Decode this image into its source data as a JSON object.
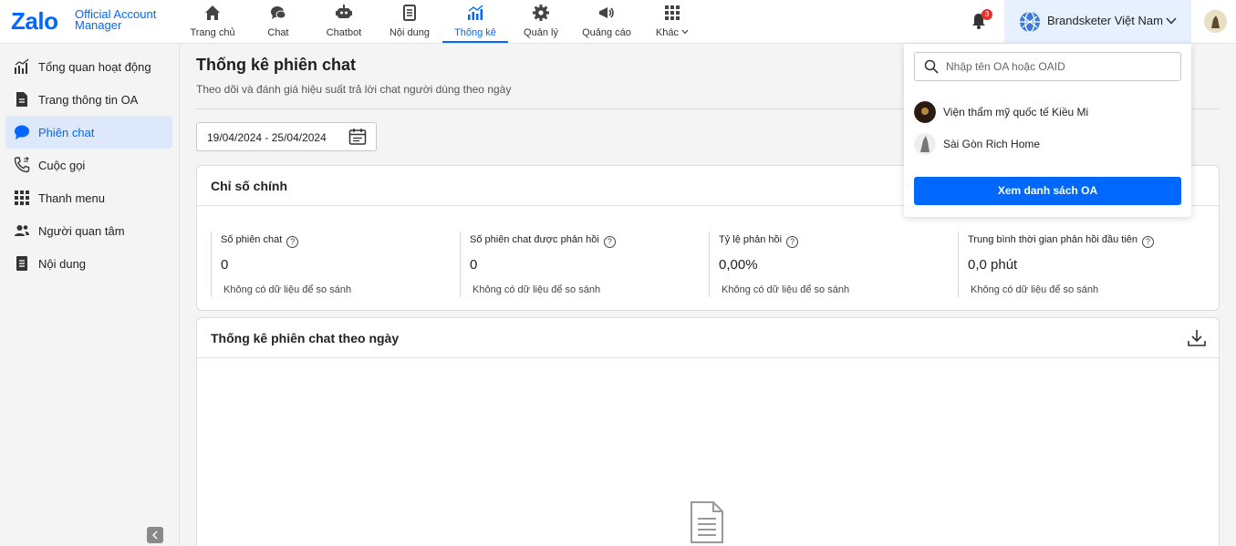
{
  "brand": {
    "logo_text": "Zalo",
    "logo_sub_1": "Official Account",
    "logo_sub_2": "Manager",
    "accent": "#0068ff"
  },
  "nav": {
    "items": [
      {
        "label": "Trang chủ",
        "icon": "home-icon"
      },
      {
        "label": "Chat",
        "icon": "chat-bubbles-icon"
      },
      {
        "label": "Chatbot",
        "icon": "robot-icon"
      },
      {
        "label": "Nội dung",
        "icon": "document-list-icon"
      },
      {
        "label": "Thống kê",
        "icon": "bar-chart-icon",
        "active": true
      },
      {
        "label": "Quản lý",
        "icon": "gear-icon"
      },
      {
        "label": "Quảng cáo",
        "icon": "megaphone-icon"
      },
      {
        "label": "Khác",
        "icon": "grid-icon"
      }
    ],
    "notification_count": "3",
    "account_name": "Brandsketer Việt Nam"
  },
  "sidebar": {
    "items": [
      {
        "label": "Tổng quan hoạt động",
        "icon": "stats-icon"
      },
      {
        "label": "Trang thông tin OA",
        "icon": "info-page-icon"
      },
      {
        "label": "Phiên chat",
        "icon": "chat-icon",
        "active": true
      },
      {
        "label": "Cuộc gọi",
        "icon": "phone-icon"
      },
      {
        "label": "Thanh menu",
        "icon": "grid-icon"
      },
      {
        "label": "Người quan tâm",
        "icon": "users-icon"
      },
      {
        "label": "Nội dung",
        "icon": "document-icon"
      }
    ]
  },
  "main": {
    "title": "Thống kê phiên chat",
    "subtitle": "Theo dõi và đánh giá hiệu suất trả lời chat người dùng theo ngày",
    "date_range": "19/04/2024 - 25/04/2024",
    "key_metrics": {
      "title": "Chỉ số chính",
      "metrics": [
        {
          "name": "Số phiên chat",
          "value": "0",
          "compare": "Không có dữ liệu để so sánh"
        },
        {
          "name": "Số phiên chat được phản hồi",
          "value": "0",
          "compare": "Không có dữ liệu để so sánh"
        },
        {
          "name": "Tỷ lệ phản hồi",
          "value": "0,00%",
          "compare": "Không có dữ liệu để so sánh"
        },
        {
          "name": "Trung bình thời gian phản hồi đầu tiên",
          "value": "0,0 phút",
          "compare": "Không có dữ liệu để so sánh"
        }
      ],
      "help_glyph": "?"
    },
    "daily_stats": {
      "title": "Thống kê phiên chat theo ngày"
    }
  },
  "dropdown": {
    "search_placeholder": "Nhập tên OA hoặc OAID",
    "oa_list": [
      {
        "name": "Viện thẩm mỹ quốc tế Kiều Mi"
      },
      {
        "name": "Sài Gòn Rich Home"
      }
    ],
    "view_all_label": "Xem danh sách OA"
  }
}
